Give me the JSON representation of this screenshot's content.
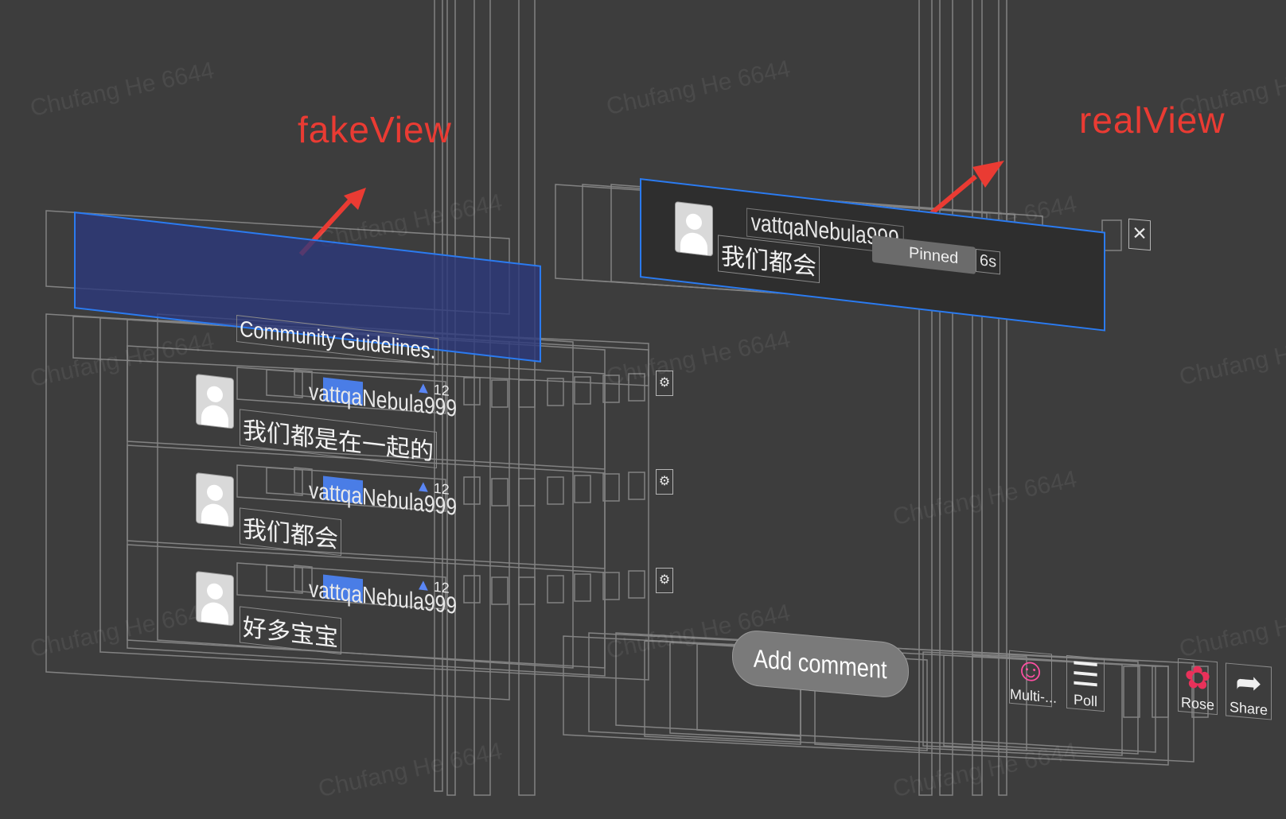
{
  "watermark": {
    "text": "Chufang He 6644"
  },
  "annotations": {
    "fake_view_label": "fakeView",
    "real_view_label": "realView",
    "arrow_color": "#ea3b33",
    "highlight_color": "#2b7bf0"
  },
  "pinned_comment": {
    "username": "vattqaNebula999",
    "pinned_label": "Pinned",
    "time": "6s",
    "message": "我们都会"
  },
  "guidelines": {
    "text": "Community Guidelines."
  },
  "comments": [
    {
      "username": "vattqaNebula999",
      "level": "12",
      "message": "我们都是在一起的"
    },
    {
      "username": "vattqaNebula999",
      "level": "12",
      "message": "我们都会"
    },
    {
      "username": "vattqaNebula999",
      "level": "12",
      "message": "好多宝宝"
    }
  ],
  "comment_bar": {
    "add_comment": "Add comment",
    "buttons": [
      {
        "icon": "multi-guest-icon",
        "label": "Multi-..."
      },
      {
        "icon": "poll-icon",
        "label": "Poll"
      },
      {
        "icon": "rose-gift-icon",
        "label": "Rose"
      },
      {
        "icon": "share-icon",
        "label": "Share"
      }
    ]
  }
}
